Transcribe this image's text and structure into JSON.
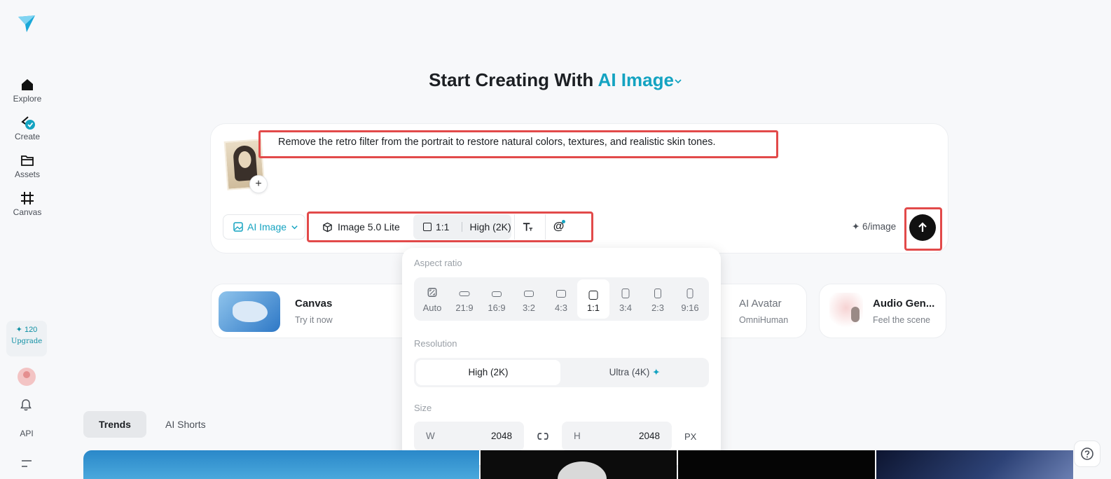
{
  "sidebar": {
    "items": [
      {
        "label": "Explore",
        "icon": "home-icon"
      },
      {
        "label": "Create",
        "icon": "create-icon"
      },
      {
        "label": "Assets",
        "icon": "folder-icon"
      },
      {
        "label": "Canvas",
        "icon": "canvas-icon"
      }
    ],
    "credits": "✦ 120",
    "upgrade_label": "Upgrade",
    "api_label": "API"
  },
  "heading": {
    "prefix": "Start Creating With ",
    "mode": "AI Image"
  },
  "prompt": {
    "text": "Remove the retro filter from the portrait to restore natural colors, textures, and realistic skin tones.",
    "add_label": "+"
  },
  "toolbar": {
    "mode_label": "AI Image",
    "model_label": "Image 5.0 Lite",
    "ratio_label": "1:1",
    "quality_label": "High (2K)",
    "mention_label": "@",
    "cost_label": "✦ 6/image"
  },
  "features": [
    {
      "title": "Canvas",
      "subtitle": "Try it now"
    },
    {
      "title": "AI Avatar",
      "subtitle": "OmniHuman"
    },
    {
      "title": "Audio Gen...",
      "subtitle": "Feel the scene"
    }
  ],
  "popup": {
    "aspect_label": "Aspect ratio",
    "ratios": [
      "Auto",
      "21:9",
      "16:9",
      "3:2",
      "4:3",
      "1:1",
      "3:4",
      "2:3",
      "9:16"
    ],
    "selected_ratio": "1:1",
    "resolution_label": "Resolution",
    "resolutions": [
      "High (2K)",
      "Ultra (4K)"
    ],
    "selected_resolution": "High (2K)",
    "size_label": "Size",
    "width_key": "W",
    "width_value": "2048",
    "height_key": "H",
    "height_value": "2048",
    "unit_label": "PX"
  },
  "tabs": [
    {
      "label": "Trends",
      "selected": true
    },
    {
      "label": "AI Shorts",
      "selected": false
    }
  ],
  "colors": {
    "accent": "#14a3c1",
    "highlight": "#e24a4a"
  }
}
